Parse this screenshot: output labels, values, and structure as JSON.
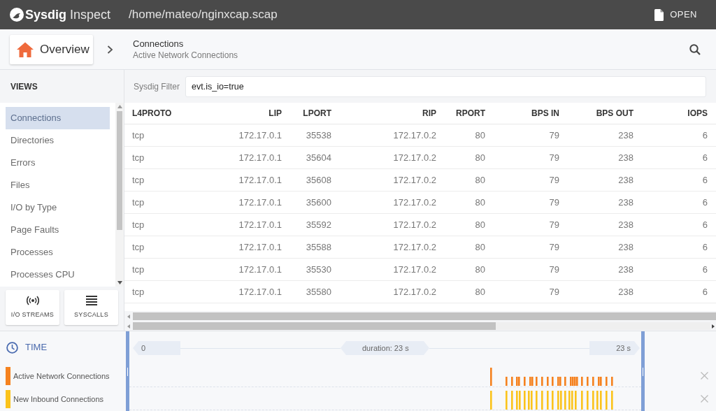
{
  "app": {
    "brand": "Sysdig",
    "product": "Inspect",
    "file_path": "/home/mateo/nginxcap.scap",
    "open_label": "OPEN"
  },
  "breadcrumb": {
    "home": "Overview",
    "title": "Connections",
    "subtitle": "Active Network Connections"
  },
  "sidebar": {
    "heading": "VIEWS",
    "items": [
      {
        "label": "Connections",
        "selected": true
      },
      {
        "label": "Directories",
        "selected": false
      },
      {
        "label": "Errors",
        "selected": false
      },
      {
        "label": "Files",
        "selected": false
      },
      {
        "label": "I/O by Type",
        "selected": false
      },
      {
        "label": "Page Faults",
        "selected": false
      },
      {
        "label": "Processes",
        "selected": false
      },
      {
        "label": "Processes CPU",
        "selected": false
      }
    ],
    "buttons": [
      {
        "label": "I/O STREAMS",
        "kind": "streams"
      },
      {
        "label": "SYSCALLS",
        "kind": "syscalls"
      }
    ]
  },
  "filter": {
    "label": "Sysdig Filter",
    "value": "evt.is_io=true"
  },
  "table": {
    "columns": [
      "L4PROTO",
      "LIP",
      "LPORT",
      "RIP",
      "RPORT",
      "BPS IN",
      "BPS OUT",
      "IOPS"
    ],
    "rows": [
      [
        "tcp",
        "172.17.0.1",
        "35538",
        "172.17.0.2",
        "80",
        "79",
        "238",
        "6"
      ],
      [
        "tcp",
        "172.17.0.1",
        "35604",
        "172.17.0.2",
        "80",
        "79",
        "238",
        "6"
      ],
      [
        "tcp",
        "172.17.0.1",
        "35608",
        "172.17.0.2",
        "80",
        "79",
        "238",
        "6"
      ],
      [
        "tcp",
        "172.17.0.1",
        "35600",
        "172.17.0.2",
        "80",
        "79",
        "238",
        "6"
      ],
      [
        "tcp",
        "172.17.0.1",
        "35592",
        "172.17.0.2",
        "80",
        "79",
        "238",
        "6"
      ],
      [
        "tcp",
        "172.17.0.1",
        "35588",
        "172.17.0.2",
        "80",
        "79",
        "238",
        "6"
      ],
      [
        "tcp",
        "172.17.0.1",
        "35530",
        "172.17.0.2",
        "80",
        "79",
        "238",
        "6"
      ],
      [
        "tcp",
        "172.17.0.1",
        "35580",
        "172.17.0.2",
        "80",
        "79",
        "238",
        "6"
      ]
    ]
  },
  "timeline": {
    "heading": "TIME",
    "start": "0",
    "duration": "duration: 23 s",
    "end": "23 s",
    "series": [
      {
        "name": "Active Network Connections",
        "color": "#f5821f"
      },
      {
        "name": "New Inbound Connections",
        "color": "#fbc31b"
      }
    ]
  }
}
